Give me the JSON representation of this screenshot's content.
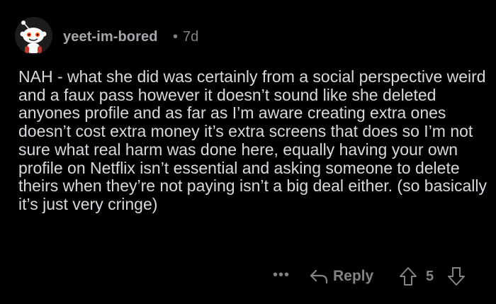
{
  "comment": {
    "username": "yeet-im-bored",
    "separator": "•",
    "age": "7d",
    "avatar_icon": "snoo-avatar-icon",
    "body": "NAH - what she did was certainly from a social perspective weird and a faux pass however it doesn’t sound like she deleted anyones profile and as far as I’m aware creating extra ones doesn’t cost extra money it’s extra screens that does so I’m not sure what real harm was done here, equally having your own profile on Netflix isn’t essential and asking someone to delete theirs when they’re not paying isn’t a big deal either. (so basically it’s just very cringe)",
    "actions": {
      "more_label": "•••",
      "reply_icon": "reply-arrow-icon",
      "reply_label": "Reply",
      "upvote_icon": "upvote-arrow-icon",
      "score": "5",
      "downvote_icon": "downvote-arrow-icon"
    }
  },
  "colors": {
    "background": "#000000",
    "text": "#d7dadc",
    "muted": "#818384"
  }
}
